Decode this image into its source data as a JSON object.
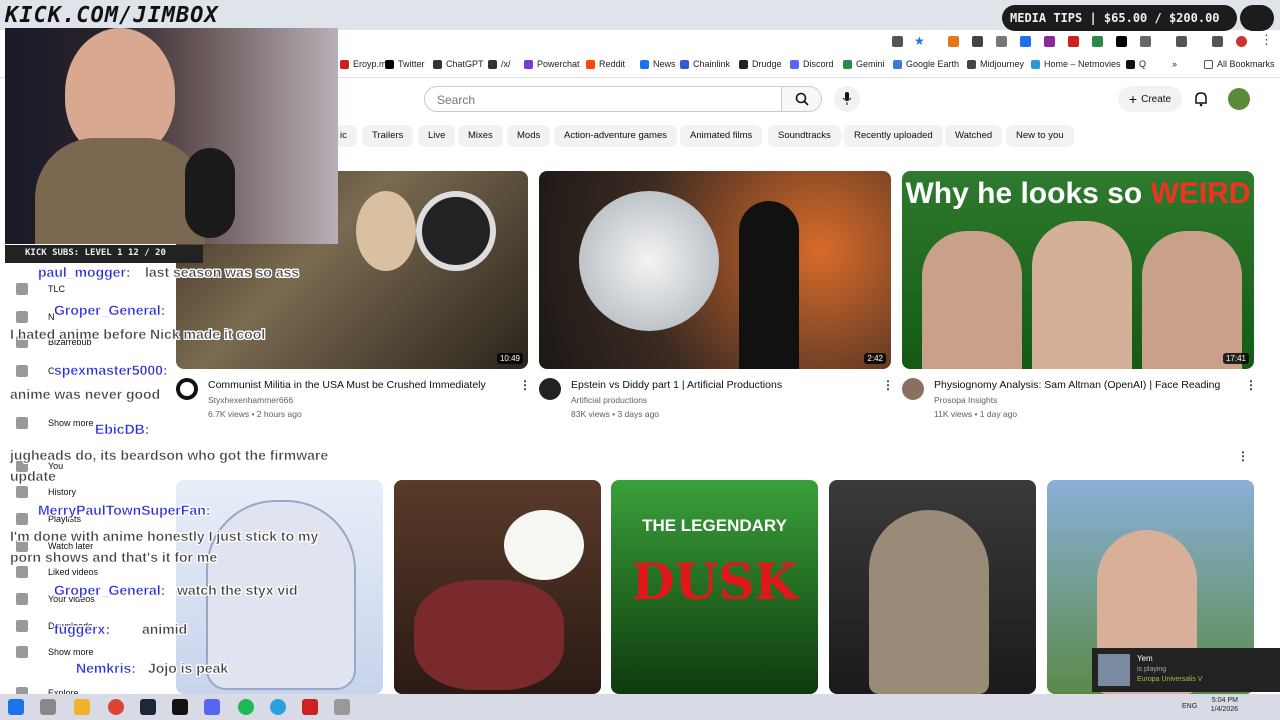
{
  "stream_overlay": {
    "banner": "KICK.COM/JIMBOX",
    "kick_subs": "KICK SUBS: LEVEL 1 12 / 20",
    "media_tips": "MEDIA TIPS | $65.00 / $200.00"
  },
  "bookmarks": [
    {
      "label": "Eroyp.me",
      "color": "#c22"
    },
    {
      "label": "Twitter",
      "color": "#000"
    },
    {
      "label": "ChatGPT",
      "color": "#333"
    },
    {
      "label": "/x/",
      "color": "#333"
    },
    {
      "label": "Powerchat",
      "color": "#7a3ad6"
    },
    {
      "label": "Reddit",
      "color": "#ff4500"
    },
    {
      "label": "News",
      "color": "#1a73e8"
    },
    {
      "label": "Chainlink",
      "color": "#375bd2"
    },
    {
      "label": "Drudge",
      "color": "#222"
    },
    {
      "label": "Discord",
      "color": "#5865f2"
    },
    {
      "label": "Gemini",
      "color": "#2a8a4a"
    },
    {
      "label": "Google Earth",
      "color": "#3a7bd5"
    },
    {
      "label": "Midjourney",
      "color": "#444"
    },
    {
      "label": "Home – Netmovies",
      "color": "#2a9ad6"
    },
    {
      "label": "Q",
      "color": "#111"
    }
  ],
  "all_bookmarks": "All Bookmarks",
  "youtube": {
    "search_placeholder": "Search",
    "create_label": "Create",
    "chips": [
      "ic",
      "Trailers",
      "Live",
      "Mixes",
      "Mods",
      "Action-adventure games",
      "Animated films",
      "Soundtracks",
      "Recently uploaded",
      "Watched",
      "New to you"
    ],
    "videos_row1": [
      {
        "title": "Communist Militia in the USA Must be Crushed Immediately",
        "channel": "Styxhexenhammer666",
        "meta": "6.7K views • 2 hours ago",
        "duration": "10:49"
      },
      {
        "title": "Epstein vs Diddy part 1 |  Artificial Productions",
        "channel": "Artificial productions",
        "meta": "83K views • 3 days ago",
        "duration": "2:42"
      },
      {
        "title": "Physiognomy Analysis: Sam Altman (OpenAI) | Face Reading",
        "channel": "Prosopa Insights",
        "meta": "11K views • 1 day ago",
        "duration": "17:41"
      }
    ],
    "thumb3_text_a": "Why he looks so ",
    "thumb3_text_b": "WEIRD",
    "thumb_dusk_a": "THE LEGENDARY",
    "thumb_dusk_b": "DUSK",
    "sidebar": [
      "TLC",
      "N",
      "Bizarrebub",
      "C",
      "Show more",
      "You",
      "History",
      "Playlists",
      "Watch later",
      "Liked videos",
      "Your videos",
      "Downloads",
      "Show more",
      "Explore"
    ]
  },
  "chat": [
    {
      "user": "paul_mogger:",
      "msg": "last season was so ass"
    },
    {
      "user": "Groper_General:",
      "msg": "I hated anime before Nick made it cool"
    },
    {
      "user": "spexmaster5000:",
      "msg": "anime was never good"
    },
    {
      "user": "EbicDB:",
      "msg": "jugheads do, its beardson who got the firmware update"
    },
    {
      "user": "MerryPaulTownSuperFan:",
      "msg": "I'm done with anime honestly I just stick to my porn shows and that's it for me"
    },
    {
      "user": "Groper_General:",
      "msg": "watch the styx vid"
    },
    {
      "user": "fuggerx:",
      "msg": "animid"
    },
    {
      "user": "Nemkris:",
      "msg": "Jojo is peak"
    }
  ],
  "toast": {
    "name": "Yem",
    "status": "is playing",
    "game": "Europa Universalis V"
  },
  "tray": {
    "lang": "ENG",
    "time": "5:04 PM",
    "date": "1/4/2026"
  }
}
